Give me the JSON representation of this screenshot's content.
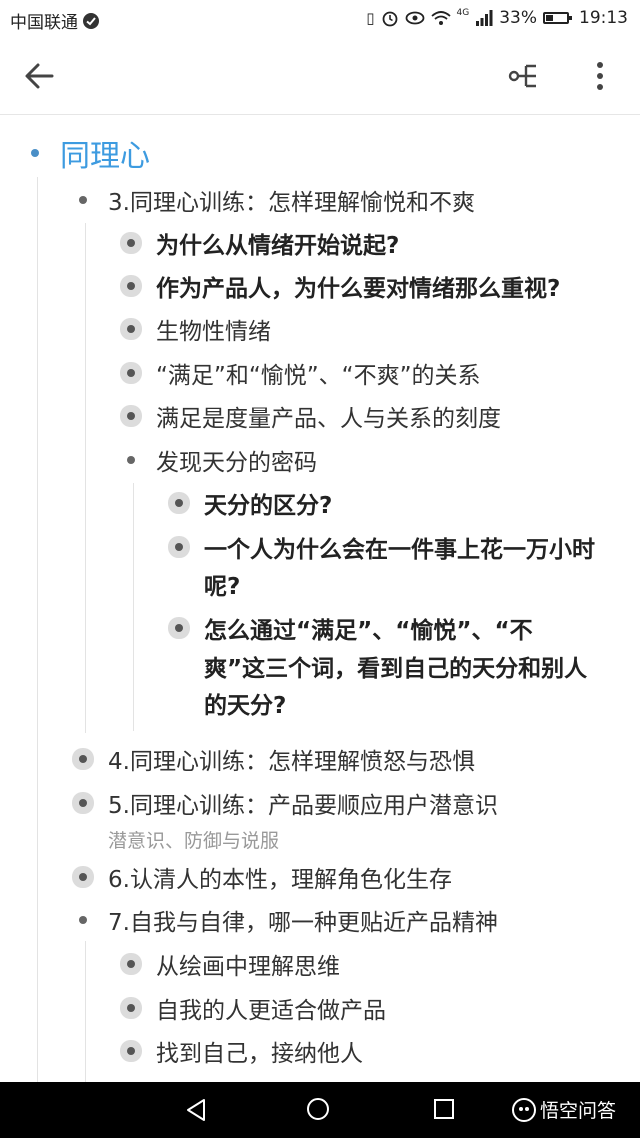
{
  "status_bar": {
    "carrier": "中国联通",
    "network": "4G",
    "battery": "33%",
    "battery_level": 0.33,
    "time": "19:13"
  },
  "toolbar": {
    "back_icon": "arrow-left-icon",
    "mindmap_icon": "mindmap-icon",
    "more_icon": "more-vertical-icon"
  },
  "outline": {
    "root": "同理心",
    "chapter3": {
      "title": "3.同理心训练：怎样理解愉悦和不爽",
      "items": [
        "为什么从情绪开始说起?",
        "作为产品人，为什么要对情绪那么重视?",
        "生物性情绪",
        "“满足”和“愉悦”、“不爽”的关系",
        "满足是度量产品、人与关系的刻度",
        "发现天分的密码"
      ],
      "sub": [
        "天分的区分?",
        "一个人为什么会在一件事上花一万小时",
        "呢?",
        "怎么通过“满足”、“愉悦”、“不",
        "爽”这三个词，看到自己的天分和别人",
        "的天分?"
      ]
    },
    "chapter4": "4.同理心训练：怎样理解愤怒与恐惧",
    "chapter5": "5.同理心训练：产品要顺应用户潜意识",
    "chapter5_note": "潜意识、防御与说服",
    "chapter6": "6.认清人的本性，理解角色化生存",
    "chapter7": {
      "title": "7.自我与自律，哪一种更贴近产品精神",
      "items": [
        "从绘画中理解思维",
        "自我的人更适合做产品",
        "找到自己，接纳他人"
      ]
    }
  },
  "nav_bar": {
    "brand": "悟空问答"
  }
}
